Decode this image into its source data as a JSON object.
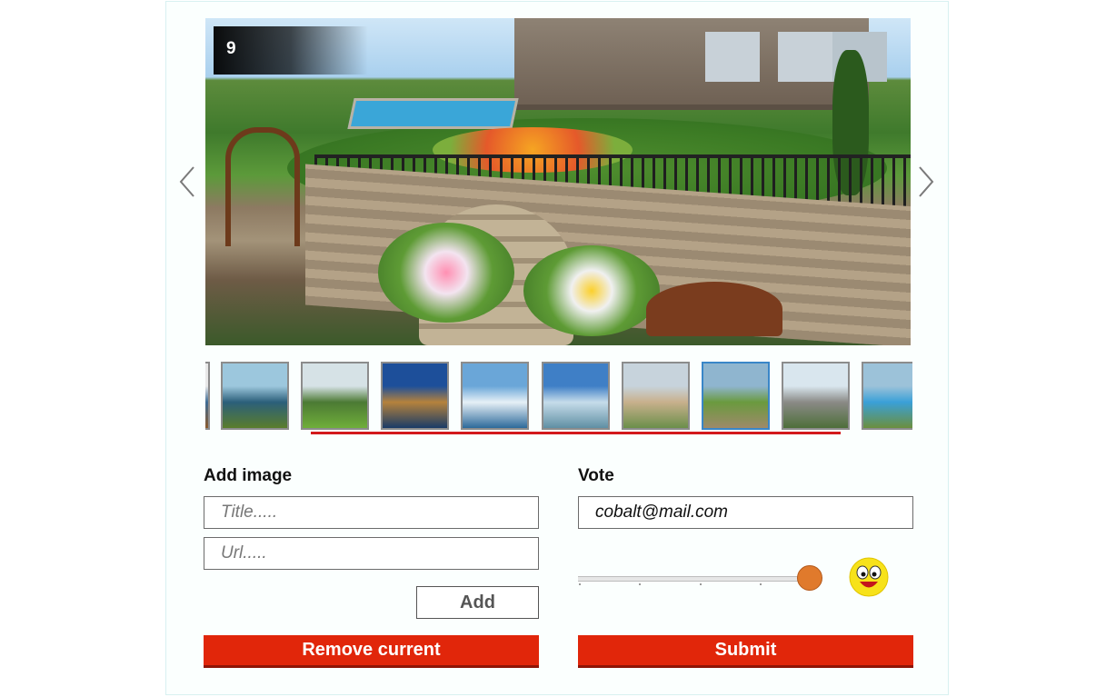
{
  "gallery": {
    "current_index": "9",
    "prev_icon": "chevron-left-icon",
    "next_icon": "chevron-right-icon",
    "thumbnails": [
      {
        "name": "thumb-partial",
        "colors": [
          "#e8e8e8",
          "#3d6b94",
          "#8b5a2b"
        ]
      },
      {
        "name": "thumb-island-puffin",
        "colors": [
          "#9cc7dd",
          "#2b5f7a",
          "#5a7d2c"
        ]
      },
      {
        "name": "thumb-green-valley",
        "colors": [
          "#d6e2e6",
          "#4c7a34",
          "#6fae3a"
        ]
      },
      {
        "name": "thumb-mountain-lake",
        "colors": [
          "#1d4f9a",
          "#b5823c",
          "#1a3b67"
        ]
      },
      {
        "name": "thumb-snow-lake",
        "colors": [
          "#6aa6d8",
          "#e6f0f6",
          "#2d6a9a"
        ]
      },
      {
        "name": "thumb-rock-lake",
        "colors": [
          "#3f7fc6",
          "#c6dcea",
          "#5f8fa3"
        ]
      },
      {
        "name": "thumb-beach",
        "colors": [
          "#c7d3dc",
          "#c8b08c",
          "#6b8f4a"
        ]
      },
      {
        "name": "thumb-garden",
        "colors": [
          "#8fb5cf",
          "#6a9a3e",
          "#9e8a6a"
        ]
      },
      {
        "name": "thumb-rocky-cliff",
        "colors": [
          "#d9e6ee",
          "#8a8a86",
          "#4e6f3a"
        ]
      },
      {
        "name": "thumb-pool-villa",
        "colors": [
          "#9cc2d9",
          "#3aa0d8",
          "#6b8f3e"
        ]
      }
    ],
    "selected_thumb": 7
  },
  "add_image": {
    "heading": "Add image",
    "title_placeholder": "Title.....",
    "url_placeholder": "Url.....",
    "add_label": "Add",
    "remove_label": "Remove current"
  },
  "vote": {
    "heading": "Vote",
    "email_value": "cobalt@mail.com",
    "slider_value": 1,
    "slider_icon": "smiley-face-icon",
    "submit_label": "Submit"
  },
  "colors": {
    "accent_red": "#e1260a",
    "divider_red": "#d3191c",
    "slider_thumb": "#e07a2c",
    "selected_border": "#3a86c8"
  }
}
